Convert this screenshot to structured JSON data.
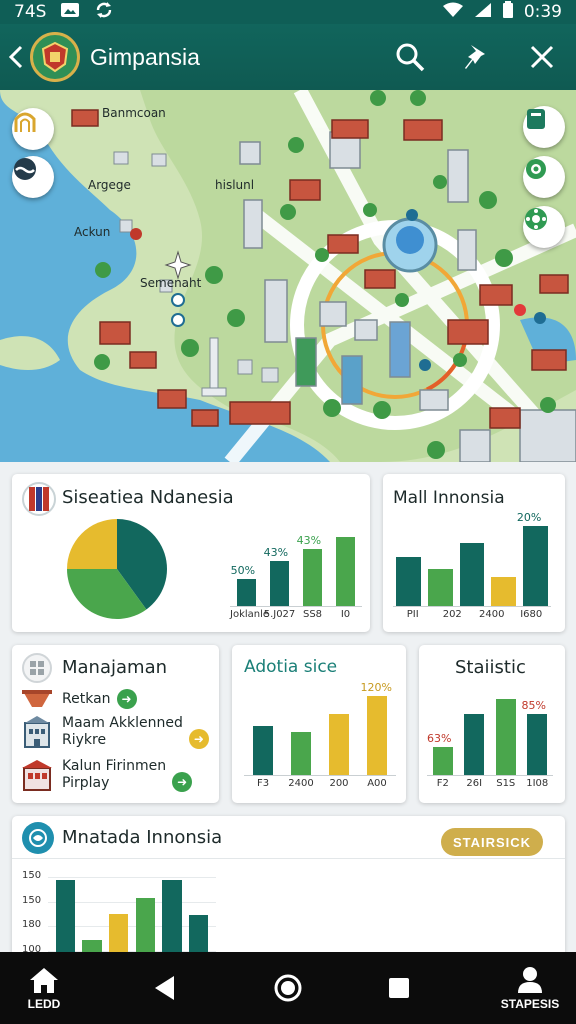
{
  "status_bar": {
    "left_text": "74S",
    "time": "0:39"
  },
  "app_bar": {
    "title": "Gimpansia"
  },
  "map": {
    "labels": [
      "Banmcoan",
      "Argege",
      "Ackun",
      "hislunl",
      "Semenaht"
    ]
  },
  "cards": {
    "c1": {
      "title": "Siseatiea Ndanesia"
    },
    "c2": {
      "title": "Mall Innonsia"
    },
    "c3": {
      "title": "Manajaman",
      "rows": [
        {
          "text": "Retkan"
        },
        {
          "text": "Maam Akklenned\nRiykre"
        },
        {
          "text": "Kalun Firinmen\nPirplay"
        }
      ]
    },
    "c4": {
      "title": "Adotia sice"
    },
    "c5": {
      "title": "Staiistic"
    },
    "c6": {
      "title": "Mnatada Innonsia",
      "chip": "STAIRSICK"
    }
  },
  "chart_data": [
    {
      "type": "pie",
      "title": "Siseatiea Ndanesia",
      "slices": [
        {
          "value": 40,
          "color": "#12685e"
        },
        {
          "value": 35,
          "color": "#4aa64c"
        },
        {
          "value": 25,
          "color": "#e6bb2e"
        }
      ]
    },
    {
      "type": "bar",
      "categories": [
        "Joklanle",
        "5.J027",
        "SS8",
        "I0"
      ],
      "values": [
        20,
        34,
        43,
        52
      ],
      "colors": [
        "#12685e",
        "#12685e",
        "#4aa64c",
        "#4aa64c"
      ],
      "data_labels": [
        "50%",
        "43%",
        "43%",
        ""
      ],
      "ylim": [
        0,
        60
      ]
    },
    {
      "type": "bar",
      "title": "Mall Innonsia",
      "categories": [
        "PII",
        "202",
        "2400",
        "I680"
      ],
      "values": [
        48,
        36,
        62,
        28,
        78
      ],
      "colors": [
        "#12685e",
        "#4aa64c",
        "#12685e",
        "#e6bb2e",
        "#12685e"
      ],
      "data_labels": [
        "",
        "",
        "",
        "",
        "20%"
      ],
      "ylim": [
        0,
        90
      ]
    },
    {
      "type": "bar",
      "title": "Adotia sice",
      "categories": [
        "F3",
        "2400",
        "200",
        "A00"
      ],
      "values": [
        44,
        38,
        54,
        70
      ],
      "colors": [
        "#12685e",
        "#4aa64c",
        "#e6bb2e",
        "#e6bb2e"
      ],
      "data_labels": [
        "",
        "",
        "",
        "120%"
      ],
      "ylim": [
        0,
        80
      ]
    },
    {
      "type": "bar",
      "title": "Staiistic",
      "categories": [
        "F2",
        "26I",
        "S1S",
        "1I08"
      ],
      "values": [
        30,
        66,
        82,
        66
      ],
      "colors": [
        "#4aa64c",
        "#12685e",
        "#4aa64c",
        "#12685e"
      ],
      "data_labels": [
        "63%",
        "",
        "",
        "85%"
      ],
      "ylim": [
        0,
        95
      ]
    },
    {
      "type": "bar",
      "title": "Mnatada Innonsia",
      "yticks": [
        "150",
        "150",
        "180",
        "100"
      ],
      "categories": [
        "",
        "",
        "",
        "",
        "",
        ""
      ],
      "values": [
        145,
        30,
        80,
        110,
        145,
        78
      ],
      "colors": [
        "#12685e",
        "#4aa64c",
        "#e6bb2e",
        "#4aa64c",
        "#12685e",
        "#12685e"
      ],
      "ylim": [
        0,
        160
      ]
    }
  ],
  "nav_bar": {
    "home_label": "LEDD",
    "profile_label": "STAPESIS"
  }
}
